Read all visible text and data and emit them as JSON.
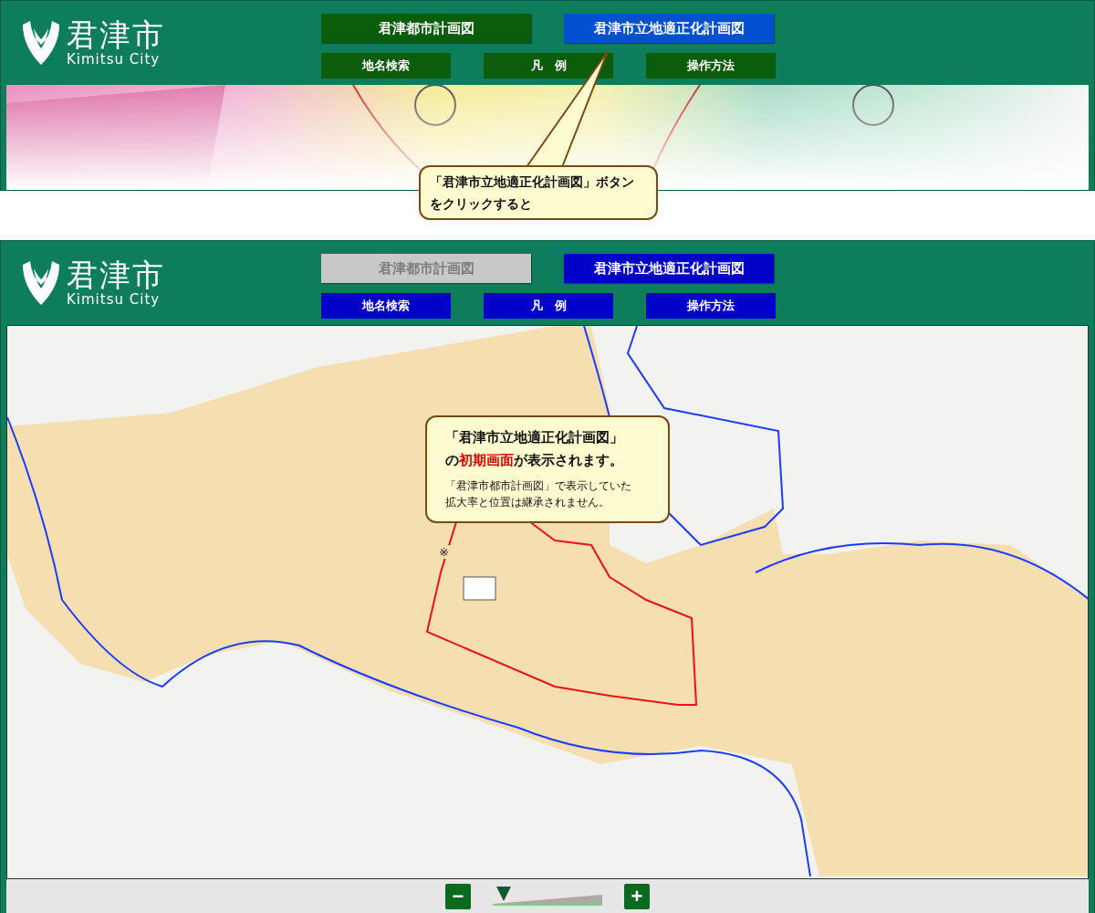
{
  "panels": [
    {
      "kind": "city-planning",
      "logo": {
        "name": "君津市",
        "subtitle": "Kimitsu City"
      },
      "tabs": [
        {
          "label": "君津都市計画図",
          "disabled": false,
          "highlighted": false
        },
        {
          "label": "君津市立地適正化計画図",
          "disabled": false,
          "highlighted": true
        }
      ],
      "buttons": [
        "地名検索",
        "凡　例",
        "操作方法"
      ],
      "callout": {
        "lines": [
          "「君津市立地適正化計画図」ボタン",
          "をクリックすると"
        ]
      }
    },
    {
      "kind": "location-plan",
      "logo": {
        "name": "君津市",
        "subtitle": "Kimitsu City"
      },
      "tabs": [
        {
          "label": "君津都市計画図",
          "disabled": true,
          "highlighted": false
        },
        {
          "label": "君津市立地適正化計画図",
          "disabled": false,
          "highlighted": false
        }
      ],
      "buttons": [
        "地名検索",
        "凡　例",
        "操作方法"
      ],
      "callout": {
        "lines": [
          "「君津市立地適正化計画図」",
          "の**初期画面**が表示されます。"
        ],
        "note": [
          "「君津市都市計画図」で表示していた",
          "拡大率と位置は継承されません。"
        ]
      },
      "map_marker": "※",
      "zoom": {
        "minus": "−",
        "plus": "+",
        "level": 0.1
      }
    }
  ]
}
